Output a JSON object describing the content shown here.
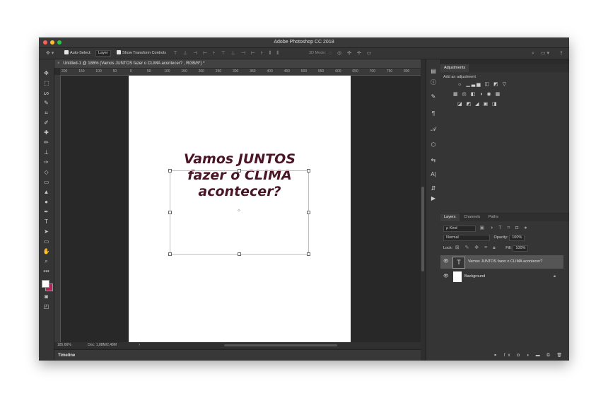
{
  "app": {
    "title": "Adobe Photoshop CC 2018"
  },
  "options_bar": {
    "auto_select_label": "Auto-Select:",
    "auto_select_value": "Layer",
    "show_transform_label": "Show Transform Controls",
    "mode_3d_label": "3D Mode:"
  },
  "document": {
    "tab_title": "Untitled-1 @ 186% (Vamos JUNTOS fazer o CLIMA acontecer? , RGB/8*) *",
    "ruler_labels": [
      "200",
      "150",
      "100",
      "50",
      "0",
      "50",
      "100",
      "150",
      "200",
      "250",
      "300",
      "350",
      "400",
      "450",
      "500",
      "550",
      "600",
      "650",
      "700",
      "750",
      "800"
    ],
    "headline_lines": [
      "Vamos JUNTOS",
      "fazer o CLIMA",
      "acontecer?"
    ],
    "headline_color": "#4a1525"
  },
  "status": {
    "zoom": "185,66%",
    "doc": "Doc: 1,88M/2,48M"
  },
  "timeline": {
    "label": "Timeline"
  },
  "adjustments": {
    "tab": "Adjustments",
    "hint": "Add an adjustment",
    "row1": "☼ ▁▃▅ ◫ ◩ ▽",
    "row2": "▦ ⚖ ◧ ◑ ◉ ▦",
    "row3": "◪ ◩ ◢ ▣ ◨"
  },
  "layers": {
    "tabs": [
      "Layers",
      "Channels",
      "Paths"
    ],
    "kind_label": "ρ Kind",
    "blend_mode": "Normal",
    "opacity_label": "Opacity:",
    "opacity_value": "100%",
    "lock_label": "Lock:",
    "fill_label": "Fill:",
    "fill_value": "100%",
    "items": [
      {
        "name": "Vamos JUNTOS fazer o CLIMA acontecer?",
        "type": "text"
      },
      {
        "name": "Background",
        "type": "background"
      }
    ]
  },
  "colors": {
    "accent_selected_layer": "#555555",
    "foreground": "#ffffff",
    "background_swatch": "#b0245a"
  }
}
